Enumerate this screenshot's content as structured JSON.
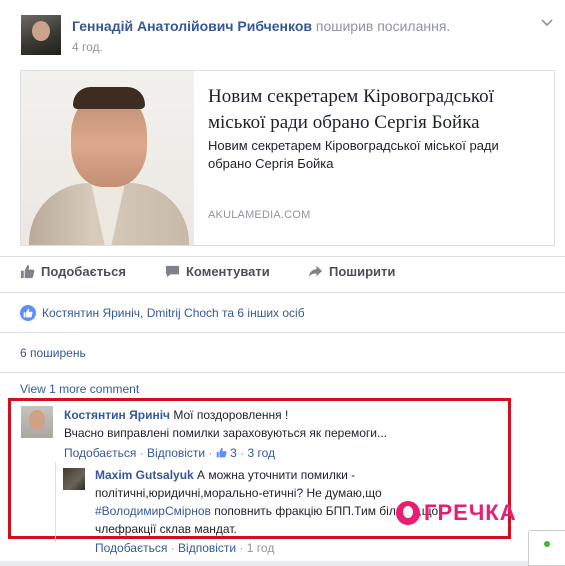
{
  "post": {
    "author": "Геннадій Анатолійович Рибченков",
    "action": "поширив посилання.",
    "time": "4 год."
  },
  "shared_link": {
    "title": "Новим секретарем Кіровоградської міської ради обрано Сергія Бойка",
    "description": "Новим секретарем Кіровоградської міської ради обрано Сергія Бойка",
    "domain": "AKULAMEDIA.COM"
  },
  "actions": {
    "like": "Подобається",
    "comment": "Коментувати",
    "share": "Поширити"
  },
  "likes_text": "Костянтин Яриніч, Dmitrij Choch та 6 інших осіб",
  "shares_text": "6 поширень",
  "view_more": "View 1 more comment",
  "comments": [
    {
      "author": "Костянтин Яриніч",
      "line1": "Мої поздоровлення !",
      "line2": "Вчасно виправлені помилки зараховуються як перемоги...",
      "like": "Подобається",
      "reply": "Відповісти",
      "like_count": "3",
      "time": "3 год"
    },
    {
      "author": "Maxim Gutsalyuk",
      "line1": "А можна уточнити помилки -",
      "line2": "політичні,юридичні,морально-етичні? Не думаю,що",
      "mention": "#ВолодимирСмірнов",
      "line3_rest": "поповнить фракцію БПП.Тим більше,що",
      "line4": "члефракції склав мандат.",
      "like": "Подобається",
      "reply": "Відповісти",
      "time": "1 год"
    }
  ],
  "watermark": "ГРЕЧКА",
  "colors": {
    "link": "#365899",
    "highlight": "#d0101f",
    "watermark": "#e91e73"
  }
}
